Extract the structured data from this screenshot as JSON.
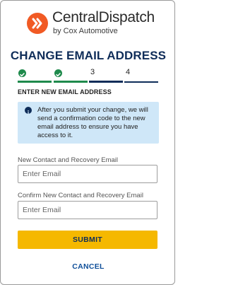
{
  "brand": {
    "name": "CentralDispatch",
    "tagline": "by Cox Automotive",
    "logo_icon": "double-chevron-logo",
    "color": "#f15a24"
  },
  "page": {
    "title": "CHANGE EMAIL ADDRESS"
  },
  "stepper": {
    "steps": [
      {
        "label": "",
        "state": "done",
        "icon": "check-circle-icon"
      },
      {
        "label": "",
        "state": "done",
        "icon": "check-circle-icon"
      },
      {
        "label": "3",
        "state": "active"
      },
      {
        "label": "4",
        "state": "todo"
      }
    ],
    "colors": {
      "done": "#1f8a4c",
      "active": "#0f2d59"
    }
  },
  "section": {
    "heading": "ENTER NEW EMAIL ADDRESS"
  },
  "info": {
    "icon": "info-icon",
    "text": "After you submit your change, we will send a confirmation code to the new email address to ensure you have access to it.",
    "background": "#cfe7f8"
  },
  "form": {
    "new_email": {
      "label": "New Contact and Recovery Email",
      "placeholder": "Enter Email",
      "value": ""
    },
    "confirm_email": {
      "label": "Confirm New Contact and Recovery Email",
      "placeholder": "Enter Email",
      "value": ""
    },
    "submit_label": "SUBMIT",
    "cancel_label": "CANCEL",
    "submit_color": "#f5b800"
  }
}
